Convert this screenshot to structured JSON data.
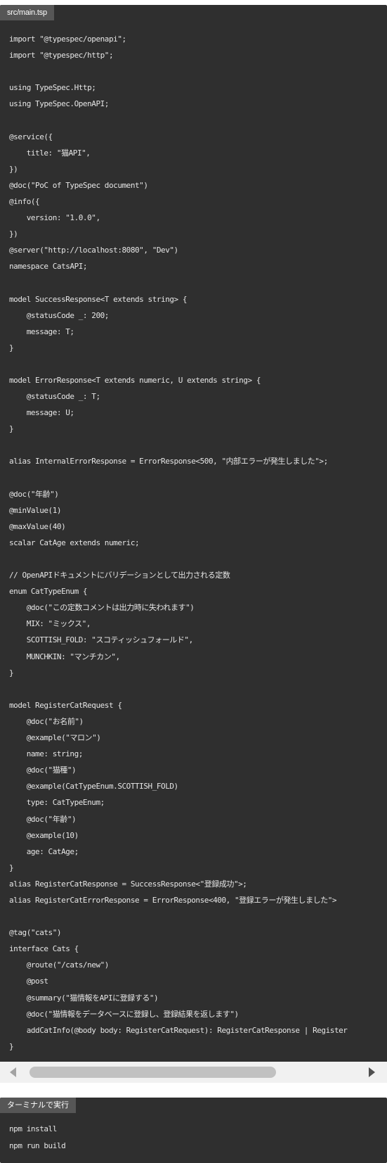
{
  "code_block": {
    "filename": "src/main.tsp",
    "lines": [
      "import \"@typespec/openapi\";",
      "import \"@typespec/http\";",
      "",
      "using TypeSpec.Http;",
      "using TypeSpec.OpenAPI;",
      "",
      "@service({",
      "    title: \"猫API\",",
      "})",
      "@doc(\"PoC of TypeSpec document\")",
      "@info({",
      "    version: \"1.0.0\",",
      "})",
      "@server(\"http://localhost:8080\", \"Dev\")",
      "namespace CatsAPI;",
      "",
      "model SuccessResponse<T extends string> {",
      "    @statusCode _: 200;",
      "    message: T;",
      "}",
      "",
      "model ErrorResponse<T extends numeric, U extends string> {",
      "    @statusCode _: T;",
      "    message: U;",
      "}",
      "",
      "alias InternalErrorResponse = ErrorResponse<500, \"内部エラーが発生しました\">;",
      "",
      "@doc(\"年齢\")",
      "@minValue(1)",
      "@maxValue(40)",
      "scalar CatAge extends numeric;",
      "",
      "// OpenAPIドキュメントにバリデーションとして出力される定数",
      "enum CatTypeEnum {",
      "    @doc(\"この定数コメントは出力時に失われます\")",
      "    MIX: \"ミックス\",",
      "    SCOTTISH_FOLD: \"スコティッシュフォールド\",",
      "    MUNCHKIN: \"マンチカン\",",
      "}",
      "",
      "model RegisterCatRequest {",
      "    @doc(\"お名前\")",
      "    @example(\"マロン\")",
      "    name: string;",
      "    @doc(\"猫種\")",
      "    @example(CatTypeEnum.SCOTTISH_FOLD)",
      "    type: CatTypeEnum;",
      "    @doc(\"年齢\")",
      "    @example(10)",
      "    age: CatAge;",
      "}",
      "alias RegisterCatResponse = SuccessResponse<\"登録成功\">;",
      "alias RegisterCatErrorResponse = ErrorResponse<400, \"登録エラーが発生しました\">",
      "",
      "@tag(\"cats\")",
      "interface Cats {",
      "    @route(\"/cats/new\")",
      "    @post",
      "    @summary(\"猫情報をAPIに登録する\")",
      "    @doc(\"猫情報をデータベースに登録し、登録結果を返します\")",
      "    addCatInfo(@body body: RegisterCatRequest): RegisterCatResponse | Register",
      "}"
    ]
  },
  "terminal_block": {
    "title": "ターミナルで実行",
    "lines": [
      "npm install",
      "npm run build"
    ]
  },
  "icons": {
    "scroll_left": "triangle-left-icon",
    "scroll_right": "triangle-right-icon"
  },
  "colors": {
    "code_background": "#2f2f2f",
    "tab_background": "#565656",
    "code_text": "#e6e6e6",
    "scrollbar_track": "#f1f1f1",
    "scrollbar_thumb": "#c1c1c1"
  }
}
